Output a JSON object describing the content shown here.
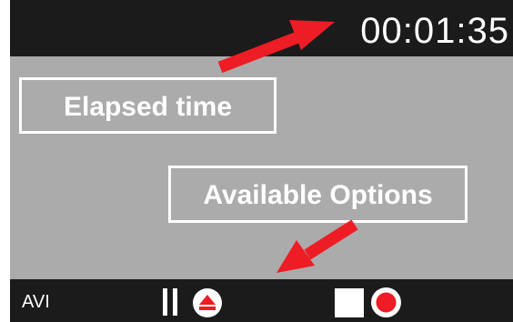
{
  "status_bar": {
    "elapsed_time": "00:01:35"
  },
  "annotations": {
    "elapsed_label": "Elapsed time",
    "options_label": "Available Options"
  },
  "controls_bar": {
    "mode_label": "AVI",
    "buttons": [
      "pause",
      "eject",
      "stop",
      "record"
    ]
  },
  "colors": {
    "bar_background": "#1b1b1b",
    "preview_background": "#ababab",
    "arrow": "#ee1c24",
    "icon_accent": "#ee1c24",
    "foreground": "#ffffff"
  },
  "icons": {
    "pause": "pause-icon",
    "eject": "eject-icon",
    "stop": "stop-icon",
    "record": "record-icon"
  }
}
